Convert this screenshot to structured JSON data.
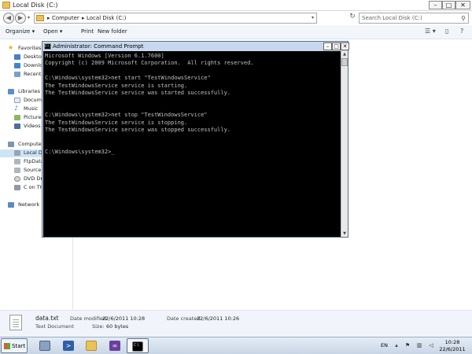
{
  "explorer": {
    "title": "Local Disk (C:)",
    "breadcrumbs": [
      "Computer",
      "Local Disk (C:)"
    ],
    "search_placeholder": "Search Local Disk (C:)",
    "toolbar": {
      "organize": "Organize ▾",
      "open": "Open ▾",
      "print": "Print",
      "new_folder": "New folder"
    },
    "nav": {
      "favorites": "Favorites",
      "favorites_items": [
        "Desktop",
        "Downlo",
        "Recent"
      ],
      "libraries": "Libraries",
      "libraries_items": [
        "Docume",
        "Music",
        "Pictures",
        "Videos"
      ],
      "computer": "Computer",
      "computer_items": [
        "Local Di",
        "FtpData",
        "Source f",
        "DVD Driv",
        "C on TH"
      ],
      "network": "Network"
    },
    "details": {
      "name": "data.txt",
      "type": "Text Document",
      "modified_label": "Date modified:",
      "modified": "22/6/2011 10:28",
      "size_label": "Size:",
      "size": "60 bytes",
      "created_label": "Date created:",
      "created": "22/6/2011 10:26"
    }
  },
  "cmd": {
    "title": "Administrator: Command Prompt",
    "lines": [
      "Microsoft Windows [Version 6.1.7600]",
      "Copyright (c) 2009 Microsoft Corporation.  All rights reserved.",
      "",
      "C:\\Windows\\system32>net start \"TestWindowsService\"",
      "The TestWindowsService service is starting.",
      "The TestWindowsService service was started successfully.",
      "",
      "",
      "C:\\Windows\\system32>net stop \"TestWindowsService\"",
      "The TestWindowsService service is stopping.",
      "The TestWindowsService service was stopped successfully.",
      "",
      "",
      "C:\\Windows\\system32>_"
    ]
  },
  "taskbar": {
    "start": "Start",
    "language": "EN",
    "time": "10:28",
    "date": "22/6/2011"
  },
  "colors": {
    "cmd_bg": "#000000",
    "cmd_text": "#c0c0c0",
    "selection": "#cce4f7"
  }
}
